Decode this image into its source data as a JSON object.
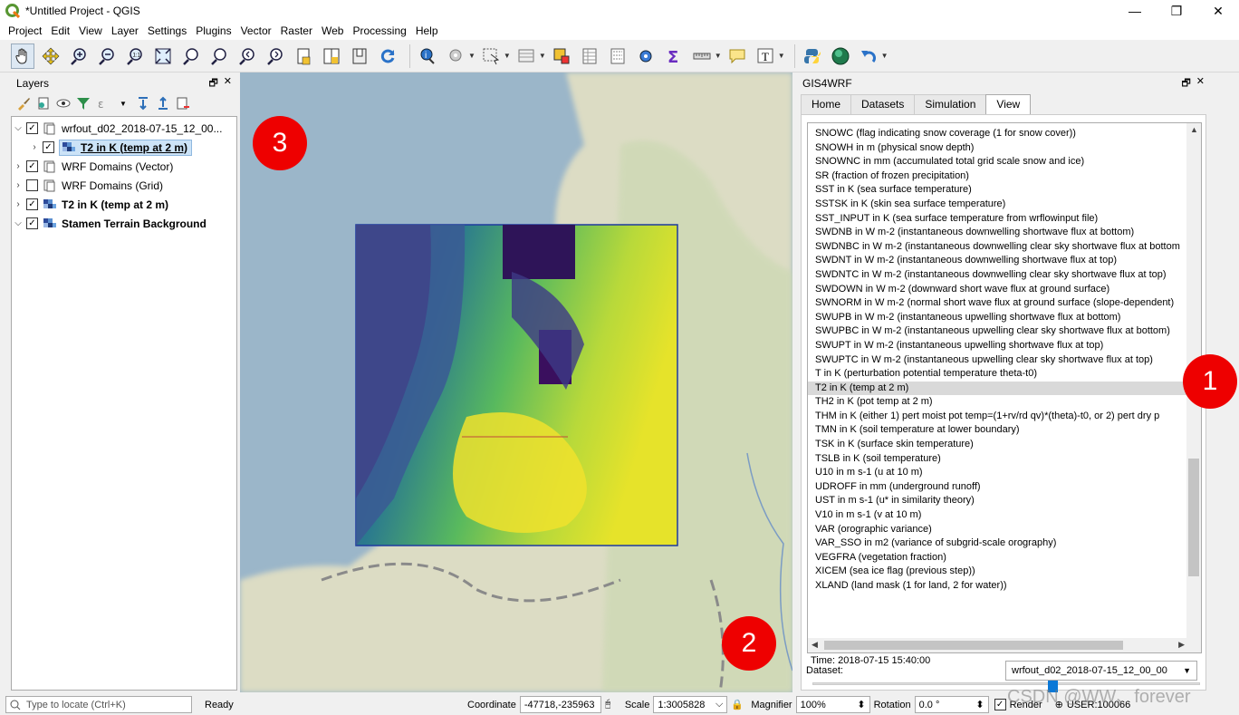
{
  "window": {
    "title": "*Untitled Project - QGIS",
    "controls": [
      "—",
      "❐",
      "✕"
    ]
  },
  "menu": [
    "Project",
    "Edit",
    "View",
    "Layer",
    "Settings",
    "Plugins",
    "Vector",
    "Raster",
    "Web",
    "Processing",
    "Help"
  ],
  "layers_panel": {
    "title": "Layers",
    "items": [
      {
        "label": "wrfout_d02_2018-07-15_12_00...",
        "checked": true,
        "expanded": true,
        "bold": false
      },
      {
        "label": "T2 in K (temp at 2 m)",
        "checked": true,
        "expanded": false,
        "bold": true,
        "selected": true
      },
      {
        "label": "WRF Domains (Vector)",
        "checked": true,
        "expanded": false,
        "bold": false
      },
      {
        "label": "WRF Domains (Grid)",
        "checked": false,
        "expanded": false,
        "bold": false
      },
      {
        "label": "T2 in K (temp at 2 m)",
        "checked": true,
        "expanded": false,
        "bold": true
      },
      {
        "label": "Stamen Terrain Background",
        "checked": true,
        "expanded": true,
        "bold": true
      }
    ]
  },
  "gis4wrf": {
    "title": "GIS4WRF",
    "tabs": [
      "Home",
      "Datasets",
      "Simulation",
      "View"
    ],
    "active_tab": "View",
    "variables": [
      "SNOWC (flag indicating snow coverage (1 for snow cover))",
      "SNOWH in m (physical snow depth)",
      "SNOWNC in mm (accumulated total grid scale snow and ice)",
      "SR (fraction of frozen precipitation)",
      "SST in K (sea surface temperature)",
      "SSTSK in K (skin sea surface temperature)",
      "SST_INPUT in K (sea surface temperature from wrflowinput file)",
      "SWDNB in W m-2 (instantaneous downwelling shortwave flux at bottom)",
      "SWDNBC in W m-2 (instantaneous downwelling clear sky shortwave flux at bottom",
      "SWDNT in W m-2 (instantaneous downwelling shortwave flux at top)",
      "SWDNTC in W m-2 (instantaneous downwelling clear sky shortwave flux at top)",
      "SWDOWN in W m-2 (downward short wave flux at ground surface)",
      "SWNORM in W m-2 (normal short wave flux at ground surface (slope-dependent)",
      "SWUPB in W m-2 (instantaneous upwelling shortwave flux at bottom)",
      "SWUPBC in W m-2 (instantaneous upwelling clear sky shortwave flux at bottom)",
      "SWUPT in W m-2 (instantaneous upwelling shortwave flux at top)",
      "SWUPTC in W m-2 (instantaneous upwelling clear sky shortwave flux at top)",
      "T in K (perturbation potential temperature theta-t0)",
      "T2 in K (temp at 2 m)",
      "TH2 in K (pot temp at 2 m)",
      "THM in K (either 1) pert moist pot temp=(1+rv/rd qv)*(theta)-t0, or 2) pert dry p",
      "TMN in K (soil temperature at lower boundary)",
      "TSK in K (surface skin temperature)",
      "TSLB in K (soil temperature)",
      "U10 in m s-1 (u at 10 m)",
      "UDROFF in mm (underground runoff)",
      "UST in m s-1 (u* in similarity theory)",
      "V10 in m s-1 (v at 10 m)",
      "VAR (orographic variance)",
      "VAR_SSO in m2 (variance of subgrid-scale orography)",
      "VEGFRA (vegetation fraction)",
      "XICEM (sea ice flag (previous step))",
      "XLAND (land mask (1 for land, 2 for water))"
    ],
    "selected_variable": "T2 in K (temp at 2 m)",
    "time_label": "Time: 2018-07-15 15:40:00",
    "time_slider_fraction": 0.62,
    "dataset_label": "Dataset:",
    "dataset_value": "wrfout_d02_2018-07-15_12_00_00"
  },
  "markers": {
    "m1": "1",
    "m2": "2",
    "m3": "3"
  },
  "statusbar": {
    "locate_placeholder": "Type to locate (Ctrl+K)",
    "ready": "Ready",
    "coordinate_label": "Coordinate",
    "coordinate_value": "-47718,-235963",
    "scale_label": "Scale",
    "scale_value": "1:3005828",
    "magnifier_label": "Magnifier",
    "magnifier_value": "100%",
    "rotation_label": "Rotation",
    "rotation_value": "0.0 °",
    "render_label": "Render",
    "user_label": "USER:100066"
  },
  "watermark": "CSDN @WW、forever",
  "colors": {
    "marker": "#ee0000",
    "accent": "#0a78d7"
  }
}
